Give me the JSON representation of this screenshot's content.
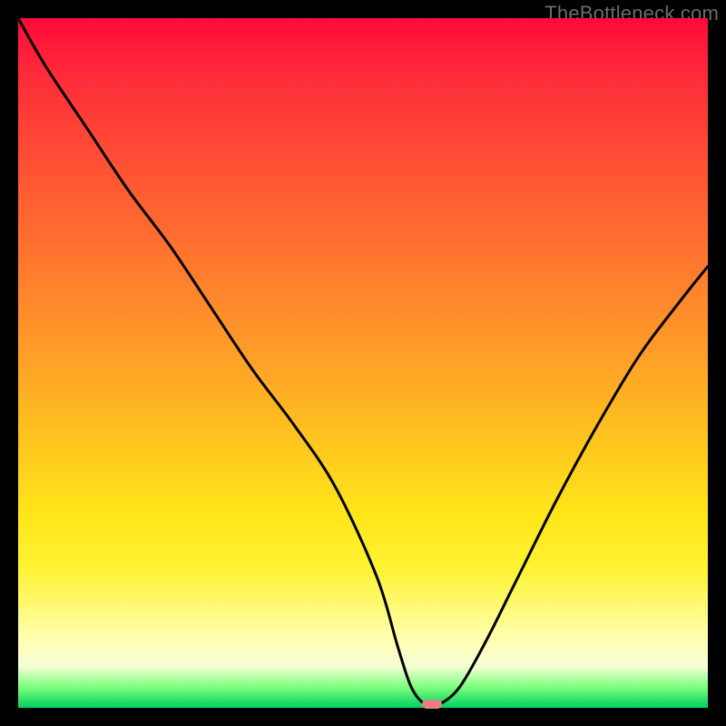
{
  "watermark": "TheBottleneck.com",
  "colors": {
    "curve": "#000000",
    "marker": "#e98080",
    "gradient_top": "#ff0a3a",
    "gradient_bottom": "#00d060"
  },
  "chart_data": {
    "type": "line",
    "title": "",
    "xlabel": "",
    "ylabel": "",
    "xlim": [
      0,
      100
    ],
    "ylim": [
      0,
      100
    ],
    "grid": false,
    "legend": false,
    "series": [
      {
        "name": "bottleneck-curve",
        "x": [
          0,
          4,
          10,
          16,
          22,
          28,
          34,
          40,
          46,
          52,
          55,
          57,
          59,
          61,
          64,
          68,
          72,
          78,
          84,
          90,
          96,
          100
        ],
        "y": [
          100,
          93,
          84,
          75,
          67,
          58,
          49,
          41,
          32,
          19,
          9,
          3,
          0.5,
          0.5,
          3,
          10,
          18,
          30,
          41,
          51,
          59,
          64
        ]
      }
    ],
    "annotations": {
      "minimum_marker": {
        "x": 60,
        "y": 0.5
      }
    }
  }
}
